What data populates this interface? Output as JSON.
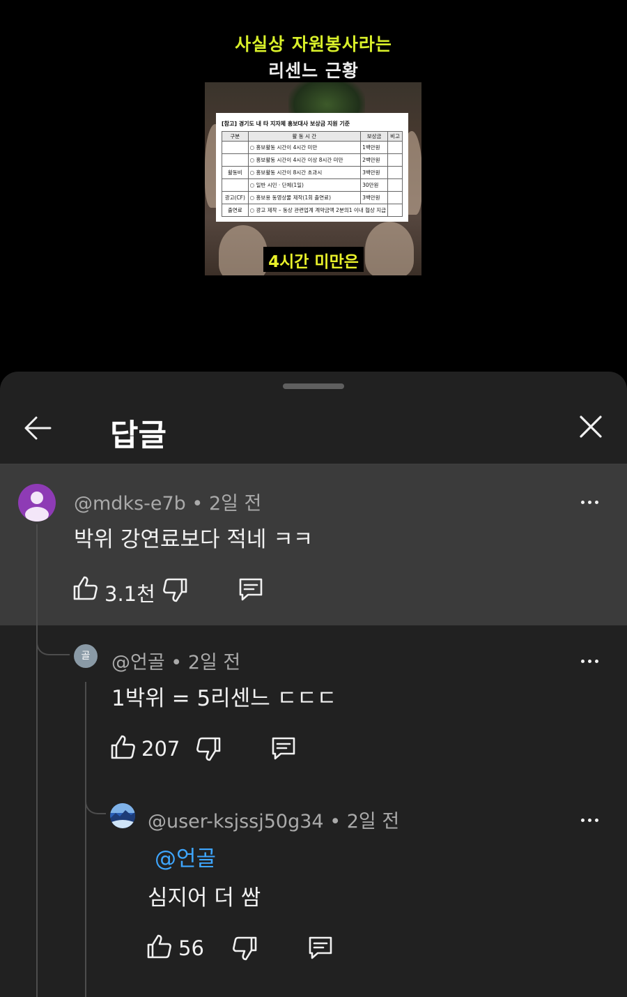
{
  "video": {
    "title_line1": "사실상 자원봉사라는",
    "title_line2": "리센느 근황",
    "caption": "4시간 미만은",
    "document": {
      "title": "[참고] 경기도 내 타 지자체 홍보대사 보상금 지원 기준",
      "headers": [
        "구분",
        "활 동 시 간",
        "보상금",
        "비고"
      ],
      "rows": [
        {
          "category": "",
          "activity": "○ 홍보활동 시간이 4시간 미만",
          "reward": "1백만원"
        },
        {
          "category": "",
          "activity": "○ 홍보활동 시간이 4시간 이상 8시간 미만",
          "reward": "2백만원"
        },
        {
          "category": "활동비",
          "activity": "○ 홍보활동 시간이 8시간 초과시",
          "reward": "3백만원"
        },
        {
          "category": "",
          "activity": "○ 일반 시민 · 단체(1일)",
          "reward": "30만원"
        },
        {
          "category": "광고(CF)",
          "activity": "○ 홍보용 동영상물 제작(1회 출연료)",
          "reward": "3백만원"
        },
        {
          "category": "출연료",
          "activity": "○ 광고 제작 – 동상 관련업계 계약금액 2분의1 이내 협상 지급",
          "reward": ""
        }
      ]
    }
  },
  "sheet": {
    "title": "답글",
    "back_icon": "arrow-left-icon",
    "close_icon": "close-icon"
  },
  "comments": [
    {
      "author": "@mdks-e7b",
      "time": "2일 전",
      "text": "박위 강연료보다 적네 ㅋㅋ",
      "likes": "3.1천",
      "avatar_color": "#8e3bb5",
      "avatar_icon": "person-icon"
    },
    {
      "author": "@언골",
      "time": "2일 전",
      "text": "1박위 = 5리센느 ㄷㄷㄷ",
      "likes": "207",
      "avatar_letter": "골",
      "avatar_color": "#8a9aa6"
    },
    {
      "author": "@user-ksjssj50g34",
      "time": "2일 전",
      "mention": "@언골",
      "text": "심지어 더 쌈",
      "likes": "56",
      "avatar_icon": "landscape-avatar-icon"
    }
  ],
  "separator": "•"
}
